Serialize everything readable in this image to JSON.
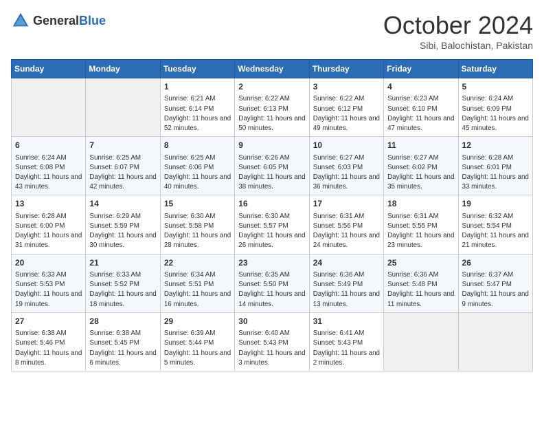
{
  "header": {
    "logo_general": "General",
    "logo_blue": "Blue",
    "month_title": "October 2024",
    "subtitle": "Sibi, Balochistan, Pakistan"
  },
  "days_of_week": [
    "Sunday",
    "Monday",
    "Tuesday",
    "Wednesday",
    "Thursday",
    "Friday",
    "Saturday"
  ],
  "weeks": [
    [
      {
        "day": "",
        "sunrise": "",
        "sunset": "",
        "daylight": ""
      },
      {
        "day": "",
        "sunrise": "",
        "sunset": "",
        "daylight": ""
      },
      {
        "day": "1",
        "sunrise": "Sunrise: 6:21 AM",
        "sunset": "Sunset: 6:14 PM",
        "daylight": "Daylight: 11 hours and 52 minutes."
      },
      {
        "day": "2",
        "sunrise": "Sunrise: 6:22 AM",
        "sunset": "Sunset: 6:13 PM",
        "daylight": "Daylight: 11 hours and 50 minutes."
      },
      {
        "day": "3",
        "sunrise": "Sunrise: 6:22 AM",
        "sunset": "Sunset: 6:12 PM",
        "daylight": "Daylight: 11 hours and 49 minutes."
      },
      {
        "day": "4",
        "sunrise": "Sunrise: 6:23 AM",
        "sunset": "Sunset: 6:10 PM",
        "daylight": "Daylight: 11 hours and 47 minutes."
      },
      {
        "day": "5",
        "sunrise": "Sunrise: 6:24 AM",
        "sunset": "Sunset: 6:09 PM",
        "daylight": "Daylight: 11 hours and 45 minutes."
      }
    ],
    [
      {
        "day": "6",
        "sunrise": "Sunrise: 6:24 AM",
        "sunset": "Sunset: 6:08 PM",
        "daylight": "Daylight: 11 hours and 43 minutes."
      },
      {
        "day": "7",
        "sunrise": "Sunrise: 6:25 AM",
        "sunset": "Sunset: 6:07 PM",
        "daylight": "Daylight: 11 hours and 42 minutes."
      },
      {
        "day": "8",
        "sunrise": "Sunrise: 6:25 AM",
        "sunset": "Sunset: 6:06 PM",
        "daylight": "Daylight: 11 hours and 40 minutes."
      },
      {
        "day": "9",
        "sunrise": "Sunrise: 6:26 AM",
        "sunset": "Sunset: 6:05 PM",
        "daylight": "Daylight: 11 hours and 38 minutes."
      },
      {
        "day": "10",
        "sunrise": "Sunrise: 6:27 AM",
        "sunset": "Sunset: 6:03 PM",
        "daylight": "Daylight: 11 hours and 36 minutes."
      },
      {
        "day": "11",
        "sunrise": "Sunrise: 6:27 AM",
        "sunset": "Sunset: 6:02 PM",
        "daylight": "Daylight: 11 hours and 35 minutes."
      },
      {
        "day": "12",
        "sunrise": "Sunrise: 6:28 AM",
        "sunset": "Sunset: 6:01 PM",
        "daylight": "Daylight: 11 hours and 33 minutes."
      }
    ],
    [
      {
        "day": "13",
        "sunrise": "Sunrise: 6:28 AM",
        "sunset": "Sunset: 6:00 PM",
        "daylight": "Daylight: 11 hours and 31 minutes."
      },
      {
        "day": "14",
        "sunrise": "Sunrise: 6:29 AM",
        "sunset": "Sunset: 5:59 PM",
        "daylight": "Daylight: 11 hours and 30 minutes."
      },
      {
        "day": "15",
        "sunrise": "Sunrise: 6:30 AM",
        "sunset": "Sunset: 5:58 PM",
        "daylight": "Daylight: 11 hours and 28 minutes."
      },
      {
        "day": "16",
        "sunrise": "Sunrise: 6:30 AM",
        "sunset": "Sunset: 5:57 PM",
        "daylight": "Daylight: 11 hours and 26 minutes."
      },
      {
        "day": "17",
        "sunrise": "Sunrise: 6:31 AM",
        "sunset": "Sunset: 5:56 PM",
        "daylight": "Daylight: 11 hours and 24 minutes."
      },
      {
        "day": "18",
        "sunrise": "Sunrise: 6:31 AM",
        "sunset": "Sunset: 5:55 PM",
        "daylight": "Daylight: 11 hours and 23 minutes."
      },
      {
        "day": "19",
        "sunrise": "Sunrise: 6:32 AM",
        "sunset": "Sunset: 5:54 PM",
        "daylight": "Daylight: 11 hours and 21 minutes."
      }
    ],
    [
      {
        "day": "20",
        "sunrise": "Sunrise: 6:33 AM",
        "sunset": "Sunset: 5:53 PM",
        "daylight": "Daylight: 11 hours and 19 minutes."
      },
      {
        "day": "21",
        "sunrise": "Sunrise: 6:33 AM",
        "sunset": "Sunset: 5:52 PM",
        "daylight": "Daylight: 11 hours and 18 minutes."
      },
      {
        "day": "22",
        "sunrise": "Sunrise: 6:34 AM",
        "sunset": "Sunset: 5:51 PM",
        "daylight": "Daylight: 11 hours and 16 minutes."
      },
      {
        "day": "23",
        "sunrise": "Sunrise: 6:35 AM",
        "sunset": "Sunset: 5:50 PM",
        "daylight": "Daylight: 11 hours and 14 minutes."
      },
      {
        "day": "24",
        "sunrise": "Sunrise: 6:36 AM",
        "sunset": "Sunset: 5:49 PM",
        "daylight": "Daylight: 11 hours and 13 minutes."
      },
      {
        "day": "25",
        "sunrise": "Sunrise: 6:36 AM",
        "sunset": "Sunset: 5:48 PM",
        "daylight": "Daylight: 11 hours and 11 minutes."
      },
      {
        "day": "26",
        "sunrise": "Sunrise: 6:37 AM",
        "sunset": "Sunset: 5:47 PM",
        "daylight": "Daylight: 11 hours and 9 minutes."
      }
    ],
    [
      {
        "day": "27",
        "sunrise": "Sunrise: 6:38 AM",
        "sunset": "Sunset: 5:46 PM",
        "daylight": "Daylight: 11 hours and 8 minutes."
      },
      {
        "day": "28",
        "sunrise": "Sunrise: 6:38 AM",
        "sunset": "Sunset: 5:45 PM",
        "daylight": "Daylight: 11 hours and 6 minutes."
      },
      {
        "day": "29",
        "sunrise": "Sunrise: 6:39 AM",
        "sunset": "Sunset: 5:44 PM",
        "daylight": "Daylight: 11 hours and 5 minutes."
      },
      {
        "day": "30",
        "sunrise": "Sunrise: 6:40 AM",
        "sunset": "Sunset: 5:43 PM",
        "daylight": "Daylight: 11 hours and 3 minutes."
      },
      {
        "day": "31",
        "sunrise": "Sunrise: 6:41 AM",
        "sunset": "Sunset: 5:43 PM",
        "daylight": "Daylight: 11 hours and 2 minutes."
      },
      {
        "day": "",
        "sunrise": "",
        "sunset": "",
        "daylight": ""
      },
      {
        "day": "",
        "sunrise": "",
        "sunset": "",
        "daylight": ""
      }
    ]
  ]
}
